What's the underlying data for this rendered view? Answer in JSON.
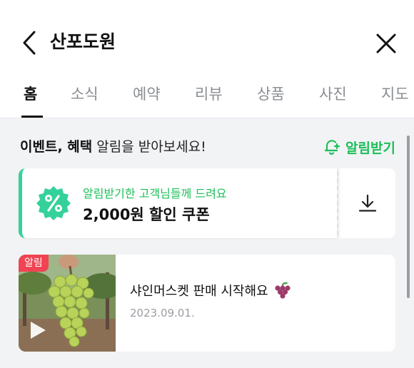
{
  "header": {
    "title": "산포도원",
    "back_icon": "chevron-left-icon",
    "close_icon": "close-icon"
  },
  "tabs": [
    {
      "label": "홈",
      "active": true
    },
    {
      "label": "소식",
      "active": false
    },
    {
      "label": "예약",
      "active": false
    },
    {
      "label": "리뷰",
      "active": false
    },
    {
      "label": "상품",
      "active": false
    },
    {
      "label": "사진",
      "active": false
    },
    {
      "label": "지도",
      "active": false
    }
  ],
  "notice": {
    "bold_text": "이벤트, 혜택",
    "rest_text": " 알림을 받아보세요!",
    "button_label": "알림받기",
    "button_icon": "bell-plus-icon"
  },
  "coupon": {
    "badge_icon": "percent-badge-icon",
    "subtitle": "알림받기한 고객님들께 드려요",
    "title": "2,000원 할인 쿠폰",
    "download_icon": "download-icon"
  },
  "news": {
    "badge": "알림",
    "title": "샤인머스켓 판매 시작해요",
    "emoji": "🍇",
    "date": "2023.09.01.",
    "play_icon": "play-icon"
  },
  "colors": {
    "accent_green": "#1bbf58",
    "coupon_mint": "#35d19a",
    "badge_red": "#f04452"
  }
}
